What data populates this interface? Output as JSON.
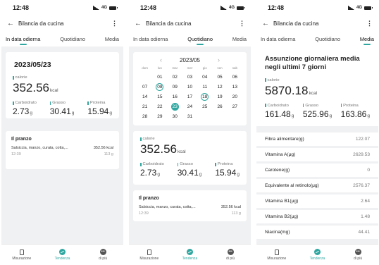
{
  "status": {
    "time": "12:48",
    "network": "4G"
  },
  "header": {
    "title": "Bilancia da cucina"
  },
  "tabs": [
    "In data odierna",
    "Quotidiano",
    "Media"
  ],
  "nav": [
    "Misurazione",
    "Tendenza",
    "di più"
  ],
  "nav_icons": [
    "scale-icon",
    "trend-icon",
    "more-icon"
  ],
  "today": {
    "date": "2023/05/23",
    "calorie_label": "calorie",
    "calorie_value": "352.56",
    "calorie_unit": "kcal",
    "macros": [
      {
        "label": "Carboidrato",
        "value": "2.73",
        "unit": "g"
      },
      {
        "label": "Grasso",
        "value": "30.41",
        "unit": "g"
      },
      {
        "label": "Proteina",
        "value": "15.94",
        "unit": "g"
      }
    ],
    "meal": {
      "title": "Il pranzo",
      "desc": "Salsiccia, manzo, curata, cotta,...",
      "kcal": "352.56 kcal",
      "time": "12:39",
      "grams": "113 g"
    }
  },
  "calendar": {
    "month": "2023/05",
    "dow": [
      "dom",
      "lun",
      "mar",
      "mer",
      "gio",
      "ven",
      "sab"
    ],
    "weeks": [
      [
        "",
        "01",
        "02",
        "03",
        "04",
        "05",
        "06"
      ],
      [
        "07",
        "08",
        "09",
        "10",
        "11",
        "12",
        "13"
      ],
      [
        "14",
        "15",
        "16",
        "17",
        "18",
        "19",
        "20"
      ],
      [
        "21",
        "22",
        "23",
        "24",
        "25",
        "26",
        "27"
      ],
      [
        "28",
        "29",
        "30",
        "31",
        "",
        "",
        ""
      ]
    ],
    "ringed": [
      "08",
      "18"
    ],
    "selected": "23"
  },
  "average": {
    "title": "Assunzione giornaliera media negli ultimi 7 giorni",
    "calorie_label": "calorie",
    "calorie_value": "5870.18",
    "calorie_unit": "kcal",
    "macros": [
      {
        "label": "Carboidrato",
        "value": "161.48",
        "unit": "g"
      },
      {
        "label": "Grasso",
        "value": "525.96",
        "unit": "g"
      },
      {
        "label": "Proteina",
        "value": "163.86",
        "unit": "g"
      }
    ],
    "nutrients": [
      {
        "label": "Fibra alimentare(g)",
        "value": "122.07"
      },
      {
        "label": "Vitamina A(μg)",
        "value": "2629.53"
      },
      {
        "label": "Carotene(g)",
        "value": "0"
      },
      {
        "label": "Equivalente al retinolo(μg)",
        "value": "2576.37"
      },
      {
        "label": "Vitamina B1(μg)",
        "value": "2.64"
      },
      {
        "label": "Vitamina B2(μg)",
        "value": "1.48"
      },
      {
        "label": "Niacina(mg)",
        "value": "44.41"
      }
    ]
  },
  "colors": {
    "accent": "#2fa7a0",
    "background": "#f0f1f3"
  }
}
